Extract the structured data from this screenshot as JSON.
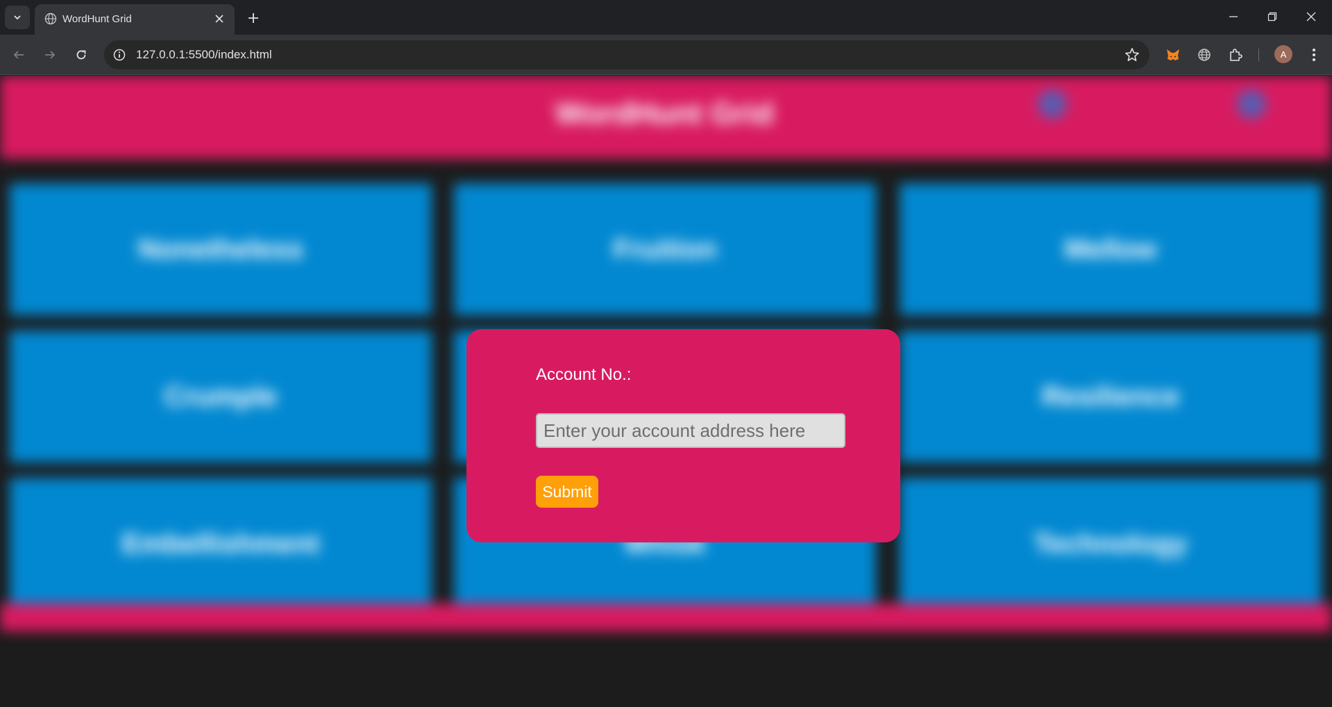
{
  "browser": {
    "tab_title": "WordHunt Grid",
    "url": "127.0.0.1:5500/index.html",
    "profile_initial": "A"
  },
  "page": {
    "header_title": "WordHunt Grid",
    "cells": [
      "Nonetheless",
      "Fruition",
      "Mellow",
      "Crumple",
      "",
      "Resilience",
      "Embellishment",
      "Whisk",
      "Technology"
    ]
  },
  "modal": {
    "label": "Account No.:",
    "input_placeholder": "Enter your account address here",
    "input_value": "",
    "submit_label": "Submit"
  },
  "colors": {
    "header_pink": "#d81b60",
    "cell_blue": "#0288d1",
    "submit_orange": "#ff9f0a"
  }
}
